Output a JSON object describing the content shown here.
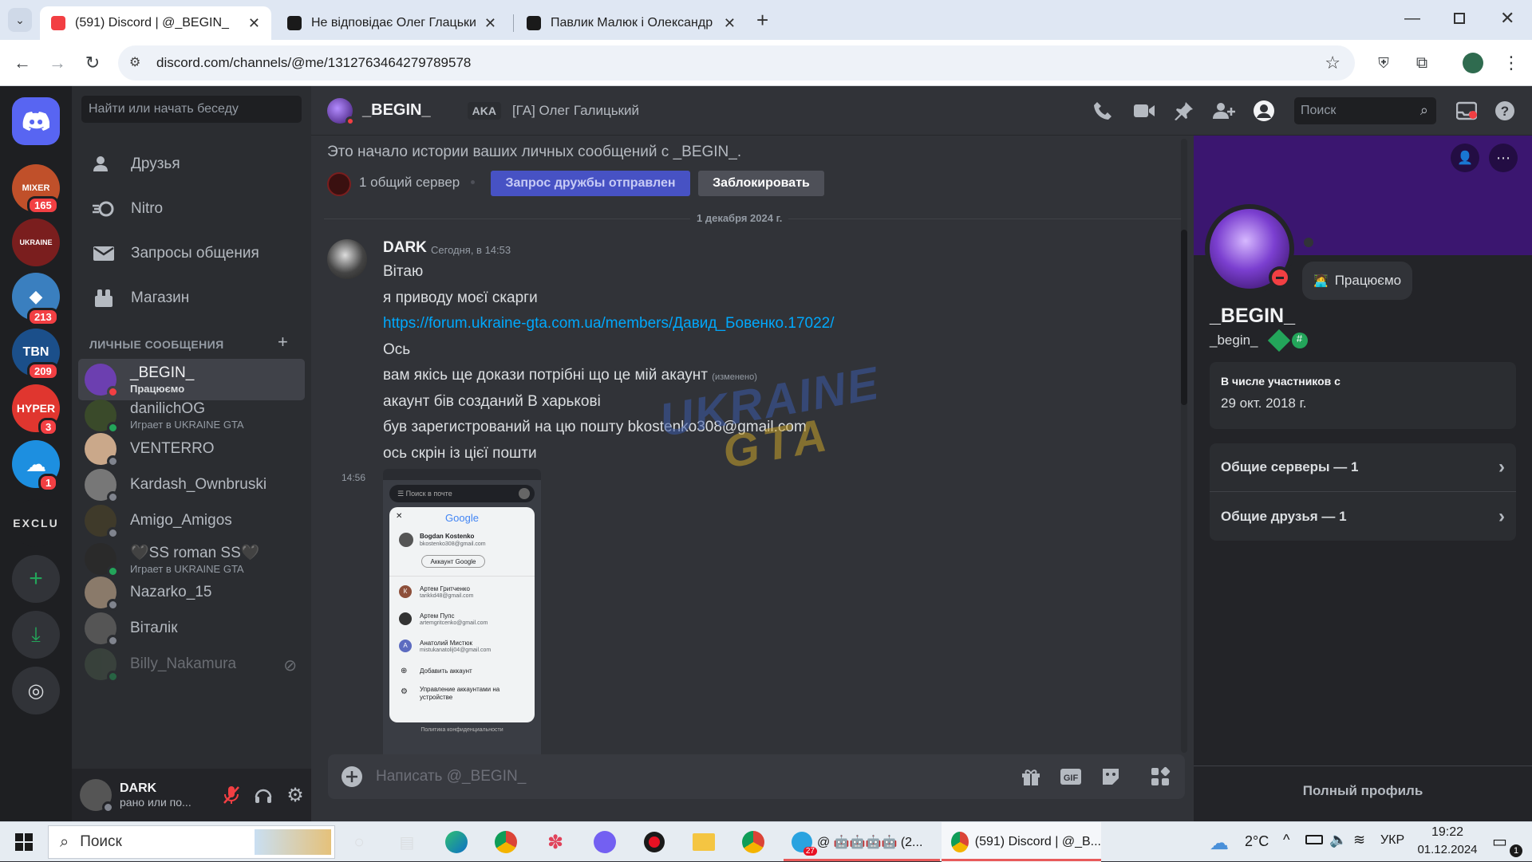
{
  "browser": {
    "tabs": [
      {
        "title": "(591) Discord | @_BEGIN_",
        "favicon_color": "#f23f43",
        "active": true
      },
      {
        "title": "Не відповідає Олег Глацький | ",
        "favicon_color": "#1a1a1a",
        "active": false
      },
      {
        "title": "Павлик Малюк і Олександр П",
        "favicon_color": "#1a1a1a",
        "active": false
      }
    ],
    "new_tab": "+",
    "url": "discord.com/channels/@me/1312763464279789578",
    "window_controls": [
      "minimize-icon",
      "restore-icon",
      "close-icon"
    ]
  },
  "guilds": {
    "items": [
      {
        "name": "home",
        "badge": ""
      },
      {
        "name": "MIXER",
        "badge": "165"
      },
      {
        "name": "UKRAINE",
        "badge": ""
      },
      {
        "name": "server-4",
        "badge": "213"
      },
      {
        "name": "TBN",
        "badge": "209"
      },
      {
        "name": "HYPER",
        "badge": "3"
      },
      {
        "name": "cloud",
        "badge": "1"
      },
      {
        "name": "EXCLU",
        "badge": ""
      }
    ],
    "add_icon": "plus-icon",
    "download_icon": "download-icon",
    "explore_icon": "compass-icon"
  },
  "dm_panel": {
    "search_placeholder": "Найти или начать беседу",
    "nav": [
      {
        "label": "Друзья",
        "icon": "friends-icon"
      },
      {
        "label": "Nitro",
        "icon": "nitro-icon"
      },
      {
        "label": "Запросы общения",
        "icon": "mail-icon"
      },
      {
        "label": "Магазин",
        "icon": "shop-icon"
      }
    ],
    "header": "ЛИЧНЫЕ СООБЩЕНИЯ",
    "add": "+",
    "dms": [
      {
        "name": "_BEGIN_",
        "sub": "Працюємо",
        "status": "#f23f43",
        "avatar": "#6c3fb0",
        "selected": true
      },
      {
        "name": "danilichOG",
        "sub": "Играет в UKRAINE GTA",
        "status": "#23a55a",
        "avatar": "#3a4a2a"
      },
      {
        "name": "VENTERRO",
        "sub": "",
        "status": "#80848e",
        "avatar": "#caa88a"
      },
      {
        "name": "Kardash_Ownbruski",
        "sub": "",
        "status": "#80848e",
        "avatar": "#777777"
      },
      {
        "name": "Amigo_Amigos",
        "sub": "",
        "status": "#80848e",
        "avatar": "#3f3a2a"
      },
      {
        "name": "🖤SS roman SS🖤",
        "sub": "Играет в UKRAINE GTA",
        "status": "#23a55a",
        "avatar": "#2a2a2a"
      },
      {
        "name": "Nazarko_15",
        "sub": "",
        "status": "#80848e",
        "avatar": "#8a7a6a"
      },
      {
        "name": "Віталік",
        "sub": "",
        "status": "#80848e",
        "avatar": "#555555"
      },
      {
        "name": "Billy_Nakamura",
        "sub": "",
        "status": "#23a55a",
        "avatar": "#4a5a4a"
      }
    ],
    "user": {
      "name": "DARK",
      "sub": "рано или по..."
    }
  },
  "chat": {
    "header_name": "_BEGIN_",
    "aka_label": "AKA",
    "aka_value": "[ГА] Олег Галицький",
    "search_placeholder": "Поиск",
    "intro": "Это начало истории ваших личных сообщений с _BEGIN_.",
    "mutual_servers": "1 общий сервер",
    "friend_request": "Запрос дружбы отправлен",
    "block": "Заблокировать",
    "date_divider": "1 декабря 2024 г.",
    "message": {
      "author": "DARK",
      "timestamp": "Сегодня, в 14:53",
      "lines": [
        "Вітаю",
        "я приводу моєї скарги",
        "https://forum.ukraine-gta.com.ua/members/Давид_Бовенко.17022/",
        "Ось",
        "вам якісь ще докази потрібні що це мій акаунт",
        "акаунт бів созданий В харькові",
        "був зарегистрований на цю пошту bkostenko308@gmail.com",
        "ось скрін із цієї пошти"
      ],
      "edited": "(изменено)",
      "image_time": "14:56"
    },
    "attachment": {
      "search": "Поиск в почте",
      "brand": "Google",
      "primary_name": "Bogdan Kostenko",
      "primary_email": "bkostenko308@gmail.com",
      "account_button": "Аккаунт Google",
      "accounts": [
        {
          "name": "Артем Гритченко",
          "email": "tarikkd48@gmail.com",
          "letter": "К"
        },
        {
          "name": "Артем Пупс",
          "email": "artemgritcenko@gmail.com",
          "letter": ""
        },
        {
          "name": "Анатолий Мистюк",
          "email": "mistukanatolij04@gmail.com",
          "letter": "A"
        }
      ],
      "add_account": "Добавить аккаунт",
      "manage_accounts": "Управление аккаунтами на устройстве",
      "privacy": "Политика конфиденциальности"
    },
    "composer_placeholder": "Написать @_BEGIN_"
  },
  "profile": {
    "name": "_BEGIN_",
    "username": "_begin_",
    "status": "Працюємо",
    "member_since_label": "В числе участников с",
    "member_since": "29 окт. 2018 г.",
    "mutual_servers": "Общие серверы — 1",
    "mutual_friends": "Общие друзья — 1",
    "full_profile": "Полный профиль",
    "banner_color": "#3b1670"
  },
  "taskbar": {
    "search": "Поиск",
    "telegram_label": "@ 🤖🤖🤖🤖 (2...",
    "telegram_badge": "27",
    "discord_label": "(591) Discord | @_B...",
    "weather": "2°C",
    "lang": "УКР",
    "time": "19:22",
    "date": "01.12.2024",
    "notif": "1"
  },
  "watermark": {
    "line1": "UKRAINE",
    "line2": "GTA"
  }
}
